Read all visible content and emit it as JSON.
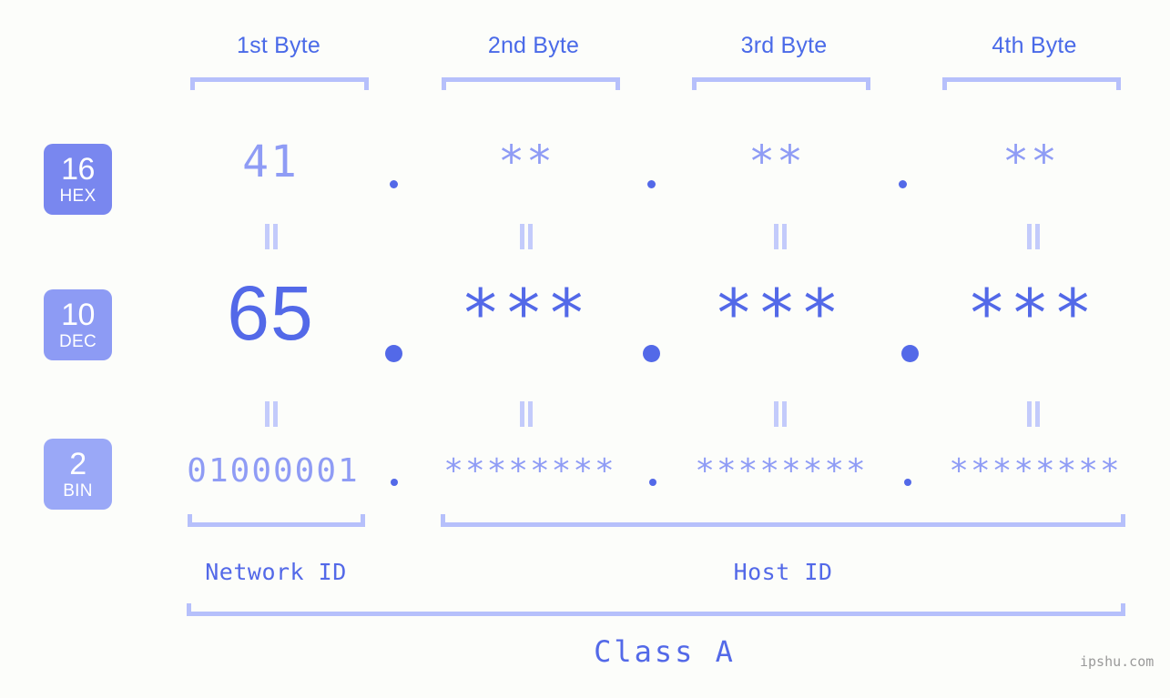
{
  "background_color": "#fcfdfa",
  "colors": {
    "header_text": "#4a6ae8",
    "bracket": "#b6c0fb",
    "hex_text": "#8f9cf5",
    "dec_text": "#5369e8",
    "bin_text": "#8f9cf5",
    "dot": "#5369e8",
    "equals_bar": "#c3cbfb",
    "badge_hex": "#7987ef",
    "badge_dec": "#8d9bf4",
    "badge_bin": "#9aa8f7",
    "badge_text": "#ffffff",
    "watermark": "#9a9a9a"
  },
  "byte_headers": [
    {
      "label": "1st Byte"
    },
    {
      "label": "2nd Byte"
    },
    {
      "label": "3rd Byte"
    },
    {
      "label": "4th Byte"
    }
  ],
  "bases": [
    {
      "number": "16",
      "name": "HEX"
    },
    {
      "number": "10",
      "name": "DEC"
    },
    {
      "number": "2",
      "name": "BIN"
    }
  ],
  "rows": {
    "hex": {
      "base_number": "16",
      "base_name": "HEX",
      "values": [
        "41",
        "**",
        "**",
        "**"
      ],
      "separator": "."
    },
    "dec": {
      "base_number": "10",
      "base_name": "DEC",
      "values": [
        "65",
        "***",
        "***",
        "***"
      ],
      "separator": "."
    },
    "bin": {
      "base_number": "2",
      "base_name": "BIN",
      "values": [
        "01000001",
        "********",
        "********",
        "********"
      ],
      "separator": "."
    }
  },
  "equality_symbol": "=",
  "id_labels": {
    "network_id": "Network ID",
    "host_id": "Host ID"
  },
  "class_label": "Class A",
  "watermark": "ipshu.com"
}
